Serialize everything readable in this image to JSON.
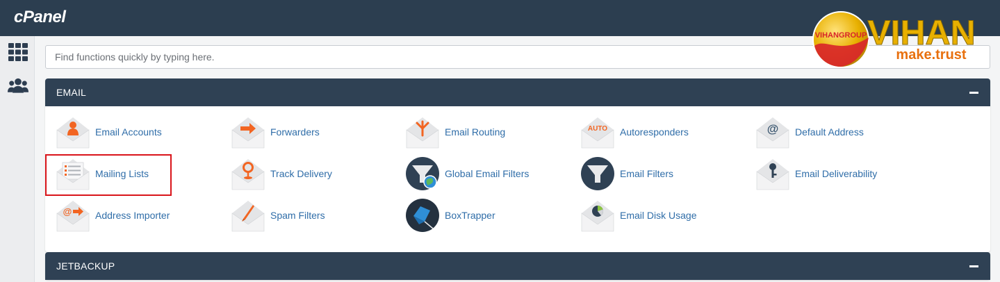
{
  "header": {
    "brand": "cPanel"
  },
  "logo": {
    "badge_text": "VIHANGROUP",
    "name": "VIHAN",
    "tagline": "make.trust",
    "colors": {
      "gold": "#e8b000",
      "red": "#d8232a",
      "orange": "#e8700e"
    }
  },
  "sidebar": {
    "items": [
      {
        "icon": "grid-icon"
      },
      {
        "icon": "users-icon"
      }
    ]
  },
  "search": {
    "placeholder": "Find functions quickly by typing here."
  },
  "sections": {
    "email": {
      "title": "EMAIL",
      "items": [
        {
          "label": "Email Accounts",
          "icon": "email-accounts-icon"
        },
        {
          "label": "Forwarders",
          "icon": "forwarders-icon"
        },
        {
          "label": "Email Routing",
          "icon": "email-routing-icon"
        },
        {
          "label": "Autoresponders",
          "icon": "autoresponders-icon",
          "icon_text": "AUTO"
        },
        {
          "label": "Default Address",
          "icon": "default-address-icon",
          "icon_text": "@"
        },
        {
          "label": "Mailing Lists",
          "icon": "mailing-lists-icon"
        },
        {
          "label": "Track Delivery",
          "icon": "track-delivery-icon"
        },
        {
          "label": "Global Email Filters",
          "icon": "global-email-filters-icon"
        },
        {
          "label": "Email Filters",
          "icon": "email-filters-icon"
        },
        {
          "label": "Email Deliverability",
          "icon": "email-deliverability-icon"
        },
        {
          "label": "Address Importer",
          "icon": "address-importer-icon",
          "icon_text": "@"
        },
        {
          "label": "Spam Filters",
          "icon": "spam-filters-icon"
        },
        {
          "label": "BoxTrapper",
          "icon": "boxtrapper-icon"
        },
        {
          "label": "Email Disk Usage",
          "icon": "email-disk-usage-icon"
        }
      ]
    },
    "jetbackup": {
      "title": "JETBACKUP"
    }
  },
  "colors": {
    "header_bg": "#2c3e50",
    "panel_head_bg": "#2f4154",
    "link": "#2f6da8",
    "highlight": "#d9141a",
    "accent_orange": "#f26522"
  }
}
